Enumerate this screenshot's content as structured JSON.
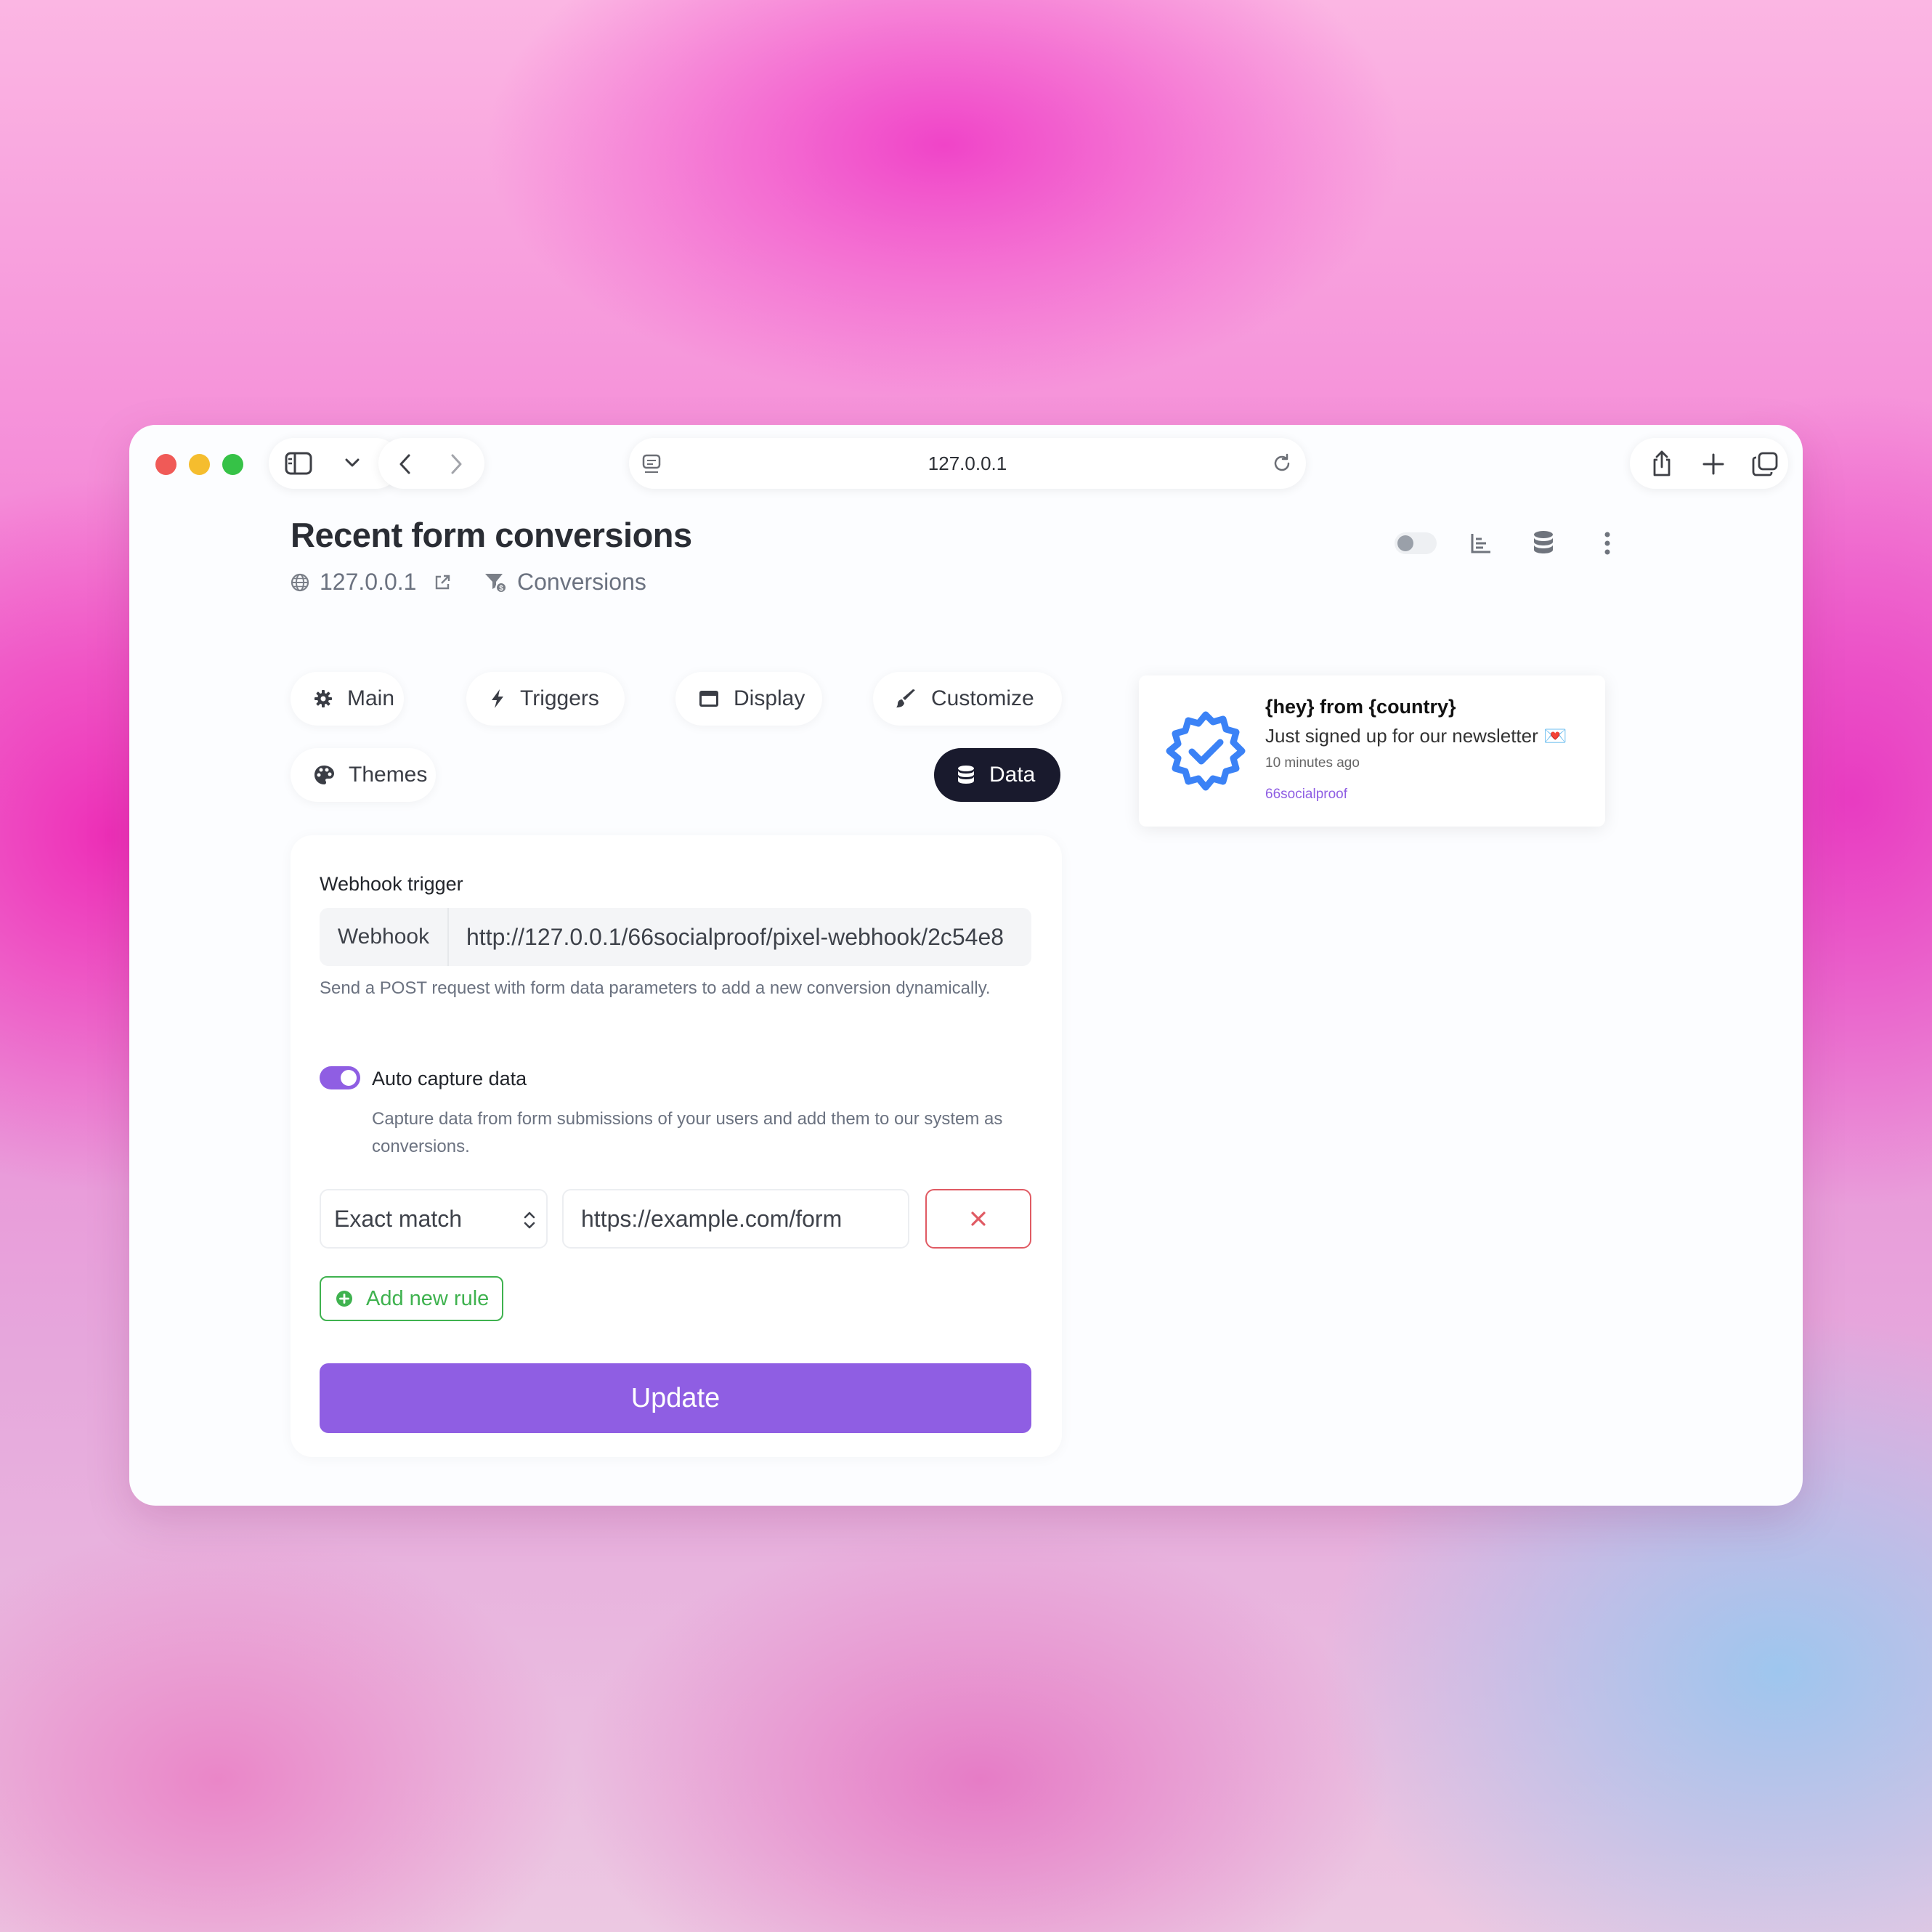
{
  "browser": {
    "url": "127.0.0.1"
  },
  "header": {
    "title": "Recent form conversions",
    "domain": "127.0.0.1",
    "type": "Conversions"
  },
  "tabs": [
    {
      "label": "Main",
      "icon": "gear-icon"
    },
    {
      "label": "Triggers",
      "icon": "bolt-icon"
    },
    {
      "label": "Display",
      "icon": "window-icon"
    },
    {
      "label": "Customize",
      "icon": "paintbrush-icon"
    },
    {
      "label": "Themes",
      "icon": "palette-icon"
    },
    {
      "label": "Data",
      "icon": "database-icon",
      "active": true
    }
  ],
  "form": {
    "webhook_label": "Webhook trigger",
    "webhook_addon": "Webhook",
    "webhook_value": "http://127.0.0.1/66socialproof/pixel-webhook/2c54e8",
    "webhook_help": "Send a POST request with form data parameters to add a new conversion dynamically.",
    "auto_capture_label": "Auto capture data",
    "auto_capture_enabled": true,
    "auto_capture_help": "Capture data from form submissions of your users and add them to our system as conversions.",
    "rule_type": "Exact match",
    "rule_value": "https://example.com/form",
    "add_rule_label": "Add new rule",
    "update_label": "Update"
  },
  "preview": {
    "title": "{hey} from {country}",
    "description": "Just signed up for our newsletter 💌",
    "time": "10 minutes ago",
    "branding": "66socialproof"
  },
  "colors": {
    "accent": "#8f5ee3",
    "dark_tab": "#191a2d",
    "success": "#3fb24f",
    "danger": "#e05a63",
    "badge_blue": "#3b82f6"
  }
}
